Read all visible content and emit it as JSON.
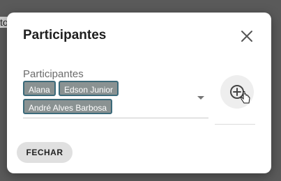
{
  "backdrop": {
    "fragment_text": "to"
  },
  "dialog": {
    "title": "Participantes",
    "close_icon": "close-icon",
    "field": {
      "label": "Participantes",
      "chips": [
        "Alana",
        "Edson Junior",
        "André Alves Barbosa"
      ],
      "dropdown_icon": "chevron-down-icon"
    },
    "add_button_icon": "add-circle-icon",
    "footer_button_label": "FECHAR"
  },
  "colors": {
    "chip_bg": "#8a9292",
    "chip_border": "#3b6a7a",
    "dialog_bg": "#ffffff",
    "backdrop": "#5a5a5a"
  }
}
